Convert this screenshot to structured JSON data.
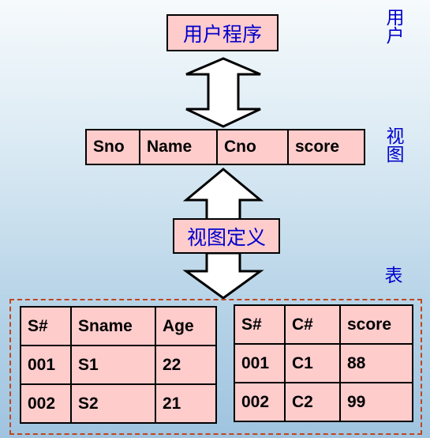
{
  "levels": {
    "user": "用户",
    "view": "视图",
    "table": "表"
  },
  "user_program": "用户程序",
  "view_definition": "视图定义",
  "view_columns": [
    "Sno",
    "Name",
    "Cno",
    "score"
  ],
  "table_s": {
    "headers": [
      "S#",
      "Sname",
      "Age"
    ],
    "rows": [
      [
        "001",
        "S1",
        "22"
      ],
      [
        "002",
        "S2",
        "21"
      ]
    ]
  },
  "table_sc": {
    "headers": [
      "S#",
      "C#",
      "score"
    ],
    "rows": [
      [
        "001",
        "C1",
        "88"
      ],
      [
        "002",
        "C2",
        "99"
      ]
    ]
  },
  "colors": {
    "box_fill": "#ffcccc",
    "label_text": "#0000cc",
    "dashed_border": "#c0461f"
  }
}
